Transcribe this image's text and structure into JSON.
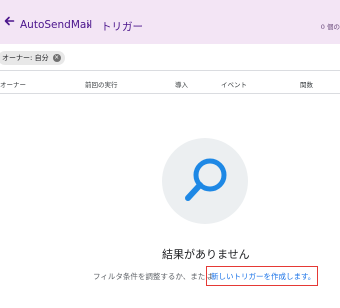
{
  "header": {
    "app_title": "AutoSendMail",
    "breadcrumb_separator": "›",
    "current_page": "トリガー",
    "trigger_count": "0 個の"
  },
  "filter": {
    "chip_label": "オーナー: 自分",
    "close_icon": "×"
  },
  "table": {
    "columns": [
      "オーナー",
      "前回の実行",
      "導入",
      "イベント",
      "関数"
    ]
  },
  "empty_state": {
    "title": "結果がありません",
    "description": "フィルタ条件を調整するか、または",
    "create_link": "新しいトリガーを作成します。"
  },
  "colors": {
    "header_bg": "#f3e5f5",
    "accent": "#4a148c",
    "link": "#1a73e8",
    "magnifier": "#1e88e5",
    "highlight_box": "#e53935"
  }
}
